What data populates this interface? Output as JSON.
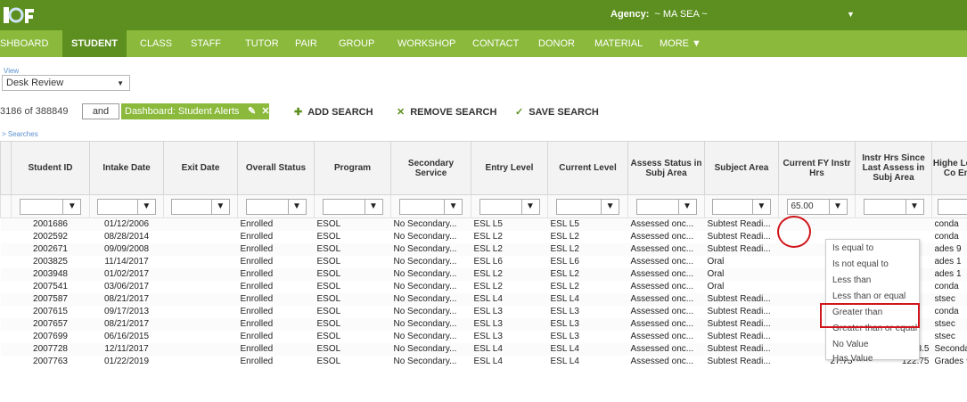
{
  "app": {
    "logo_text": "LACES",
    "agency_label": "Agency:",
    "agency_value": "~ MA SEA ~"
  },
  "nav": [
    "SHBOARD",
    "STUDENT",
    "CLASS",
    "STAFF",
    "TUTOR",
    "PAIR",
    "GROUP",
    "WORKSHOP",
    "CONTACT",
    "DONOR",
    "MATERIAL",
    "MORE ▼"
  ],
  "nav_active": "STUDENT",
  "view": {
    "label": "View",
    "selected": "Desk Review"
  },
  "search": {
    "count": "3186 of 388849",
    "conjunction": "and",
    "chip": "Dashboard: Student Alerts",
    "add": "ADD SEARCH",
    "remove": "REMOVE SEARCH",
    "save": "SAVE SEARCH",
    "searches_link": "> Searches"
  },
  "columns": [
    "Student ID",
    "Intake Date",
    "Exit Date",
    "Overall Status",
    "Program",
    "Secondary Service",
    "Entry Level",
    "Current Level",
    "Assess Status in Subj Area",
    "Subject Area",
    "Current FY Instr Hrs",
    "Instr Hrs Since Last Assess in Subj Area",
    "Highe Level Co Ent"
  ],
  "filter": {
    "current_fy_value": "65.00"
  },
  "rows": [
    [
      "2001686",
      "01/12/2006",
      "",
      "Enrolled",
      "ESOL",
      "No Secondary...",
      "ESL L5",
      "ESL L5",
      "Assessed onc...",
      "Subtest Readi...",
      "",
      "",
      "conda"
    ],
    [
      "2002592",
      "08/28/2014",
      "",
      "Enrolled",
      "ESOL",
      "No Secondary...",
      "ESL L2",
      "ESL L2",
      "Assessed onc...",
      "Subtest Readi...",
      "",
      "",
      "conda"
    ],
    [
      "2002671",
      "09/09/2008",
      "",
      "Enrolled",
      "ESOL",
      "No Secondary...",
      "ESL L2",
      "ESL L2",
      "Assessed onc...",
      "Subtest Readi...",
      "",
      "",
      "ades 9"
    ],
    [
      "2003825",
      "11/14/2017",
      "",
      "Enrolled",
      "ESOL",
      "No Secondary...",
      "ESL L6",
      "ESL L6",
      "Assessed onc...",
      "Oral",
      "",
      "",
      "ades 1"
    ],
    [
      "2003948",
      "01/02/2017",
      "",
      "Enrolled",
      "ESOL",
      "No Secondary...",
      "ESL L2",
      "ESL L2",
      "Assessed onc...",
      "Oral",
      "",
      "",
      "ades 1"
    ],
    [
      "2007541",
      "03/06/2017",
      "",
      "Enrolled",
      "ESOL",
      "No Secondary...",
      "ESL L2",
      "ESL L2",
      "Assessed onc...",
      "Oral",
      "",
      "",
      "conda"
    ],
    [
      "2007587",
      "08/21/2017",
      "",
      "Enrolled",
      "ESOL",
      "No Secondary...",
      "ESL L4",
      "ESL L4",
      "Assessed onc...",
      "Subtest Readi...",
      "",
      "",
      "stsec"
    ],
    [
      "2007615",
      "09/17/2013",
      "",
      "Enrolled",
      "ESOL",
      "No Secondary...",
      "ESL L3",
      "ESL L3",
      "Assessed onc...",
      "Subtest Readi...",
      "",
      "",
      "conda"
    ],
    [
      "2007657",
      "08/21/2017",
      "",
      "Enrolled",
      "ESOL",
      "No Secondary...",
      "ESL L3",
      "ESL L3",
      "Assessed onc...",
      "Subtest Readi...",
      "",
      "",
      "stsec"
    ],
    [
      "2007699",
      "06/16/2015",
      "",
      "Enrolled",
      "ESOL",
      "No Secondary...",
      "ESL L3",
      "ESL L3",
      "Assessed onc...",
      "Subtest Readi...",
      "",
      "",
      "stsec"
    ],
    [
      "2007728",
      "12/11/2017",
      "",
      "Enrolled",
      "ESOL",
      "No Secondary...",
      "ESL L4",
      "ESL L4",
      "Assessed onc...",
      "Subtest Readi...",
      "32.5",
      "93.5",
      "Seconda"
    ],
    [
      "2007763",
      "01/22/2019",
      "",
      "Enrolled",
      "ESOL",
      "No Secondary...",
      "ESL L4",
      "ESL L4",
      "Assessed onc...",
      "Subtest Readi...",
      "27.75",
      "122.75",
      "Grades 9"
    ]
  ],
  "filter_menu": [
    "Is equal to",
    "Is not equal to",
    "Less than",
    "Less than or equal",
    "Greater than",
    "Greater than or equal",
    "No Value",
    "Has Value"
  ],
  "colors": {
    "topbar": "#5c8f1f",
    "navbar": "#8ab93b",
    "highlight": "#d0161c"
  }
}
